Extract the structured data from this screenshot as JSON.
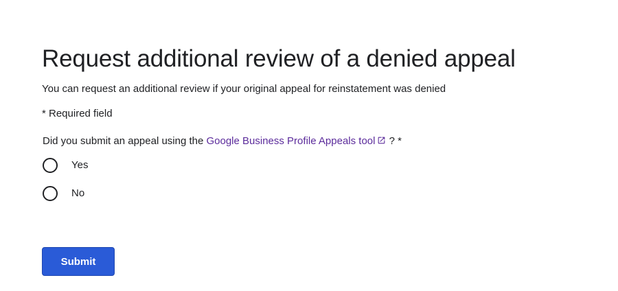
{
  "form": {
    "title": "Request additional review of a denied appeal",
    "subtitle": "You can request an additional review if your original appeal for reinstatement was denied",
    "required_note": "* Required field",
    "question": {
      "prefix": "Did you submit an appeal using the ",
      "link_text": "Google Business Profile Appeals tool",
      "suffix": " ? *",
      "link_icon": "external-link-icon",
      "link_color": "#5b2b9b"
    },
    "options": [
      {
        "label": "Yes",
        "selected": false
      },
      {
        "label": "No",
        "selected": false
      }
    ],
    "submit_label": "Submit",
    "submit_color": "#2a5bd7"
  }
}
